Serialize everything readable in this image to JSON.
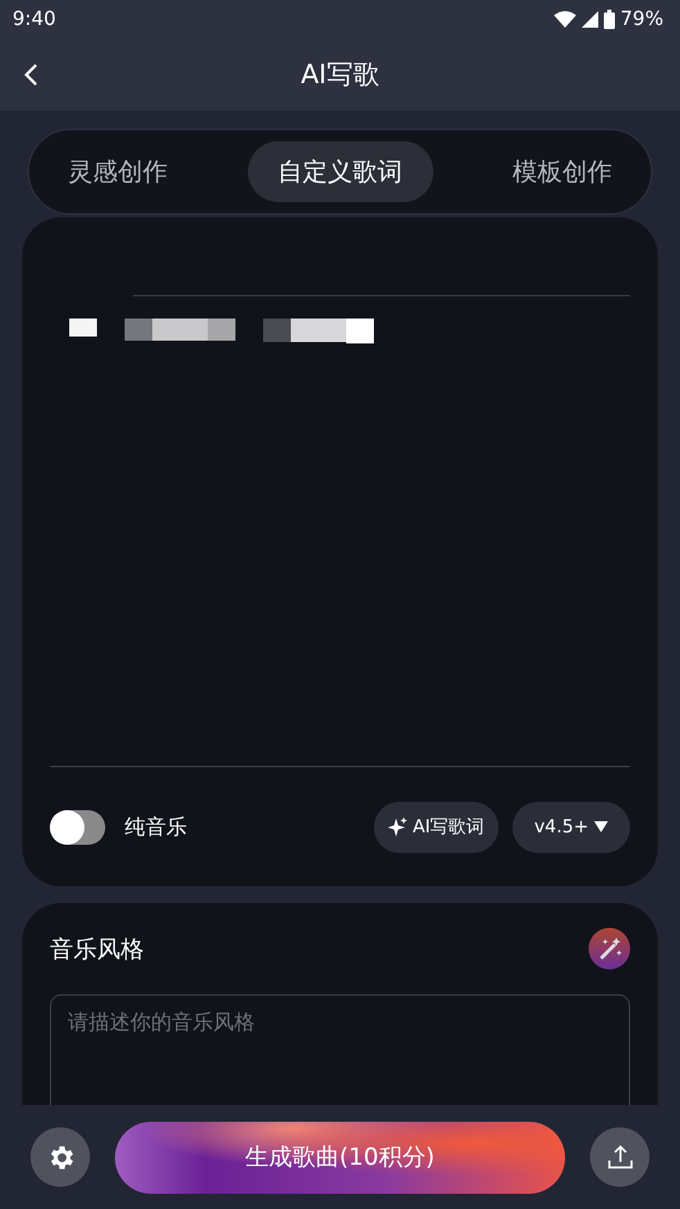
{
  "status_bar": {
    "time": "9:40",
    "battery": "79%"
  },
  "header": {
    "title": "AI写歌"
  },
  "tabs": [
    {
      "label": "灵感创作",
      "selected": false
    },
    {
      "label": "自定义歌词",
      "selected": true
    },
    {
      "label": "模板创作",
      "selected": false
    }
  ],
  "lyrics_card": {
    "instrumental": {
      "label": "纯音乐",
      "on": false
    },
    "ai_lyrics_button": "AI写歌词",
    "model_button": "v4.5+"
  },
  "style_card": {
    "title": "音乐风格",
    "field": {
      "placeholder": "请描述你的音乐风格"
    }
  },
  "bottom_bar": {
    "generate_button": "生成歌曲(10积分)"
  }
}
